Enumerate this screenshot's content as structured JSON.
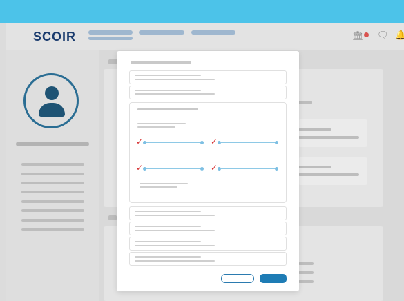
{
  "header": {
    "logo_text": "SCOIR",
    "brand_color": "#4cc3e9",
    "logo_color": "#1b3c6e"
  },
  "icons": {
    "profile": "user-icon",
    "messages": "chat-icon",
    "notifications": "bell-icon",
    "college": "building-icon"
  },
  "modal": {
    "primary_color": "#1e7cb5",
    "checkmark_color": "#d63031"
  }
}
